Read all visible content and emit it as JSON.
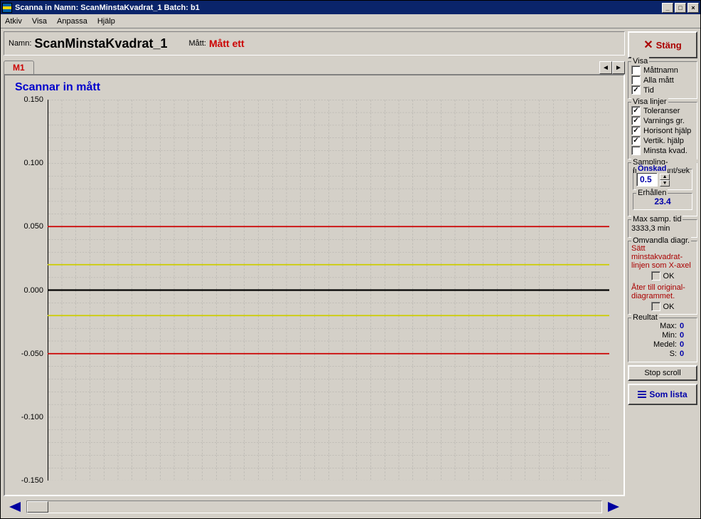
{
  "titlebar": {
    "text": "Scanna in    Namn: ScanMinstaKvadrat_1    Batch: b1"
  },
  "menu": {
    "items": [
      "Atkiv",
      "Visa",
      "Anpassa",
      "Hjälp"
    ]
  },
  "header": {
    "namn_label": "Namn:",
    "namn_value": "ScanMinstaKvadrat_1",
    "matt_label": "Mått:",
    "matt_value": "Mått ett"
  },
  "tabs": {
    "active": "M1"
  },
  "close_btn": "Stäng",
  "visa": {
    "legend": "Visa",
    "mattnamn": {
      "label": "Måttnamn",
      "checked": false
    },
    "alla": {
      "label": "Alla mått",
      "checked": false
    },
    "tid": {
      "label": "Tid",
      "checked": true
    }
  },
  "visa_linjer": {
    "legend": "Visa linjer",
    "tol": {
      "label": "Toleranser",
      "checked": true
    },
    "varn": {
      "label": "Varnings gr.",
      "checked": true
    },
    "hor": {
      "label": "Horisont hjälp",
      "checked": true
    },
    "vert": {
      "label": "Vertik. hjälp",
      "checked": true
    },
    "minsta": {
      "label": "Minsta kvad.",
      "checked": false
    }
  },
  "sampling": {
    "legend": "Sampling-frekvens ant/sek",
    "onskad_label": "Önskad",
    "onskad_value": "0.5",
    "erhallen_label": "Erhållen",
    "erhallen_value": "23.4"
  },
  "maxsamp": {
    "label": "Max samp. tid",
    "value": "3333,3 min"
  },
  "omvandla": {
    "legend": "Omvandla diagr.",
    "text1": "Sätt minstakvadrat-linjen som X-axel",
    "ok": "OK",
    "text2": "Åter till original-diagrammet."
  },
  "resultat": {
    "legend": "Reultat",
    "rows": [
      {
        "k": "Max:",
        "v": "0"
      },
      {
        "k": "Min:",
        "v": "0"
      },
      {
        "k": "Medel:",
        "v": "0"
      },
      {
        "k": "S:",
        "v": "0"
      }
    ]
  },
  "stop_scroll": "Stop scroll",
  "som_lista": "Som lista",
  "chart_data": {
    "type": "line",
    "title": "Scannar in mått",
    "ylabel": "",
    "xlabel": "",
    "ylim": [
      -0.15,
      0.15
    ],
    "yticks": [
      0.15,
      0.1,
      0.05,
      0.0,
      -0.05,
      -0.1,
      -0.15
    ],
    "ytick_labels": [
      "0.150",
      "0.100",
      "0.050",
      "0.000",
      "-0.050",
      "-0.100",
      "-0.150"
    ],
    "reference_lines": [
      {
        "y": 0.05,
        "color": "red",
        "name": "upper_tolerance"
      },
      {
        "y": 0.02,
        "color": "yellow",
        "name": "upper_warning"
      },
      {
        "y": 0.0,
        "color": "black",
        "name": "zero"
      },
      {
        "y": -0.02,
        "color": "yellow",
        "name": "lower_warning"
      },
      {
        "y": -0.05,
        "color": "red",
        "name": "lower_tolerance"
      }
    ],
    "series": []
  }
}
